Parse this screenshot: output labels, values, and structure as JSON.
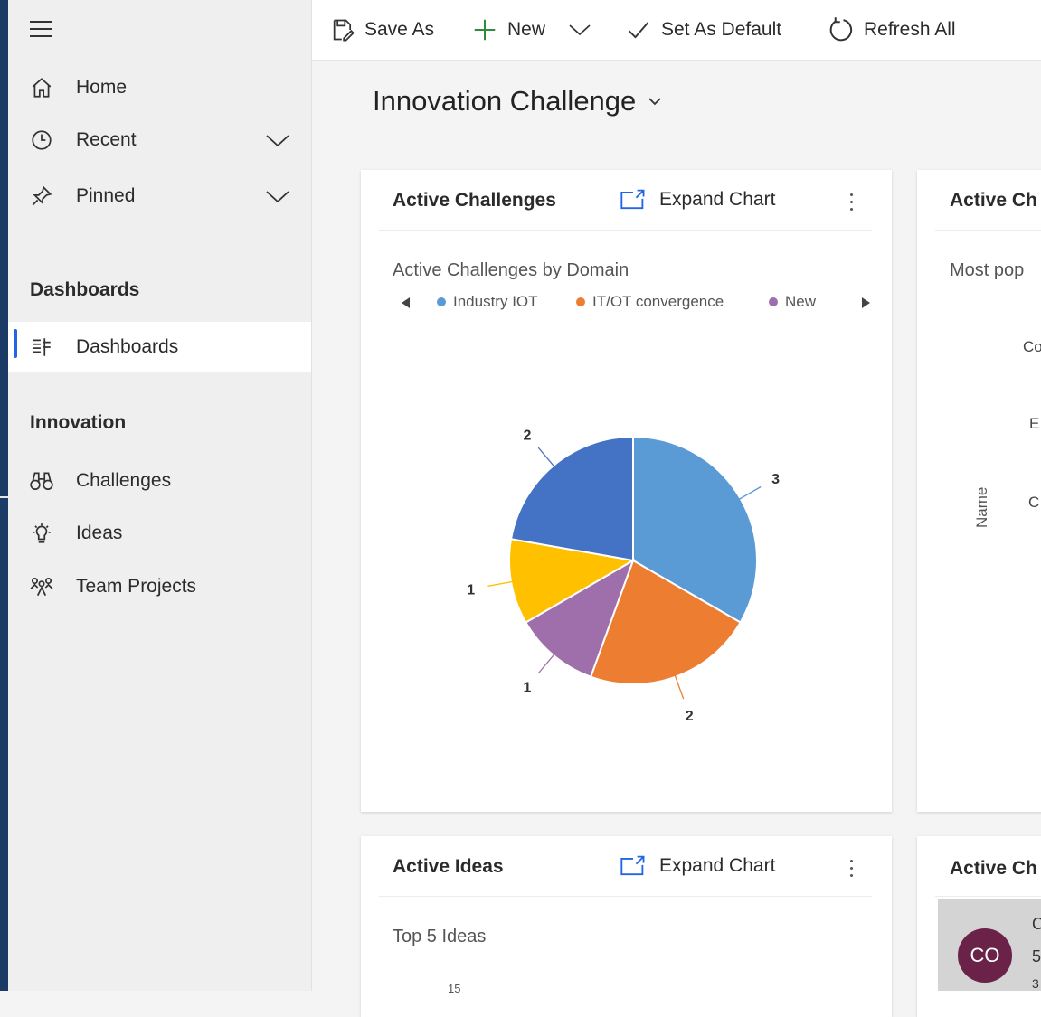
{
  "sidebar": {
    "nav": [
      {
        "label": "Home"
      },
      {
        "label": "Recent"
      },
      {
        "label": "Pinned"
      }
    ],
    "section_dashboards": "Dashboards",
    "dashboards_item": "Dashboards",
    "section_innovation": "Innovation",
    "innovation_items": [
      {
        "label": "Challenges"
      },
      {
        "label": "Ideas"
      },
      {
        "label": "Team Projects"
      }
    ]
  },
  "commandbar": {
    "save_as": "Save As",
    "new": "New",
    "set_default": "Set As Default",
    "refresh_all": "Refresh All"
  },
  "dashboard": {
    "title": "Innovation Challenge"
  },
  "cards": {
    "active_challenges": {
      "title": "Active Challenges",
      "expand": "Expand Chart",
      "chart_title": "Active Challenges by Domain"
    },
    "active_ch_partial": {
      "title": "Active Ch",
      "subtitle": "Most pop",
      "axis_label": "Name",
      "categories": [
        "Co",
        "E",
        "C"
      ]
    },
    "active_ideas": {
      "title": "Active Ideas",
      "expand": "Expand Chart",
      "chart_title": "Top 5 Ideas",
      "tick_partial": "15"
    },
    "active_ch_partial_2": {
      "title": "Active Ch",
      "avatar_initials": "CO",
      "peek": [
        "C",
        "5",
        "3"
      ]
    }
  },
  "colors": {
    "accent": "#2266e3",
    "series": [
      "#5b9bd5",
      "#ed7d31",
      "#9e6fab",
      "#ffc000",
      "#4472c4"
    ]
  },
  "chart_data": {
    "type": "pie",
    "title": "Active Challenges by Domain",
    "legend": [
      "Industry IOT",
      "IT/OT convergence",
      "New"
    ],
    "legend_placement": "top",
    "slices": [
      {
        "name": "Industry IOT",
        "value": 3,
        "color": "#5b9bd5"
      },
      {
        "name": "IT/OT convergence",
        "value": 2,
        "color": "#ed7d31"
      },
      {
        "name": "New",
        "value": 1,
        "color": "#9e6fab"
      },
      {
        "name": "",
        "value": 1,
        "color": "#ffc000"
      },
      {
        "name": "",
        "value": 2,
        "color": "#4472c4"
      }
    ]
  }
}
